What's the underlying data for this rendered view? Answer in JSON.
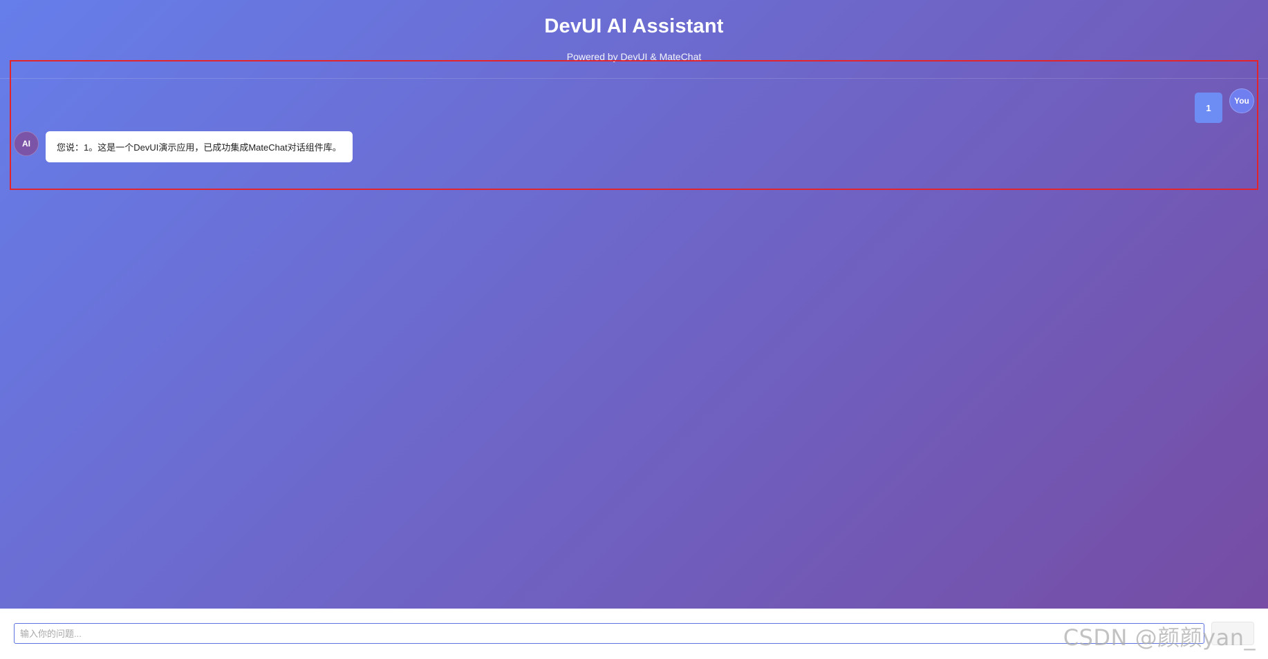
{
  "header": {
    "title": "DevUI AI Assistant",
    "subtitle": "Powered by DevUI & MateChat"
  },
  "messages": [
    {
      "role": "user",
      "avatar_label": "You",
      "text": "1"
    },
    {
      "role": "ai",
      "avatar_label": "AI",
      "text": "您说：1。这是一个DevUI演示应用，已成功集成MateChat对话组件库。"
    }
  ],
  "input": {
    "placeholder": "输入你的问题...",
    "value": ""
  },
  "send_button": {
    "label": ""
  },
  "watermark": {
    "text": "CSDN @颜颜yan_"
  },
  "colors": {
    "background_gradient_start": "#667eea",
    "background_gradient_end": "#764ba2",
    "user_bubble": "#6d8df5",
    "ai_avatar": "#7b53a7",
    "highlight_border": "#e3242b"
  }
}
